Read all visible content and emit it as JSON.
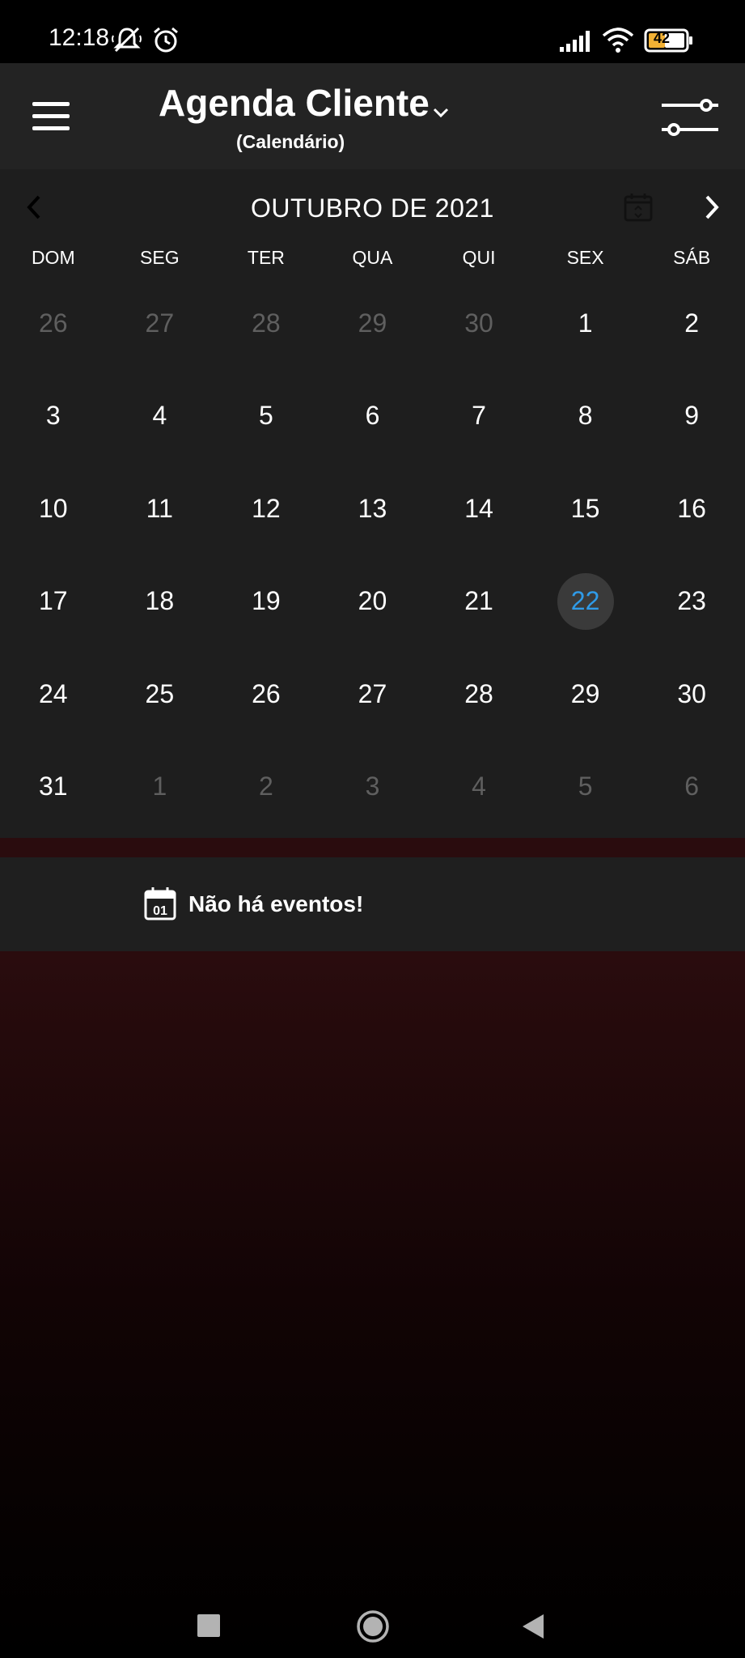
{
  "status_bar": {
    "time": "12:18",
    "battery": "42",
    "icons": [
      "muted-bell-icon",
      "alarm-icon",
      "signal-icon",
      "wifi-icon",
      "battery-icon"
    ]
  },
  "app_bar": {
    "title": "Agenda Cliente",
    "subtitle": "(Calendário)",
    "icons": [
      "menu-icon",
      "chevron-down-icon",
      "filter-sliders-icon"
    ]
  },
  "calendar": {
    "month_label": "OUTUBRO DE 2021",
    "weekdays": [
      "DOM",
      "SEG",
      "TER",
      "QUA",
      "QUI",
      "SEX",
      "SÁB"
    ],
    "weeks": [
      [
        {
          "d": "26",
          "m": true
        },
        {
          "d": "27",
          "m": true
        },
        {
          "d": "28",
          "m": true
        },
        {
          "d": "29",
          "m": true
        },
        {
          "d": "30",
          "m": true
        },
        {
          "d": "1"
        },
        {
          "d": "2"
        }
      ],
      [
        {
          "d": "3"
        },
        {
          "d": "4"
        },
        {
          "d": "5"
        },
        {
          "d": "6"
        },
        {
          "d": "7"
        },
        {
          "d": "8"
        },
        {
          "d": "9"
        }
      ],
      [
        {
          "d": "10"
        },
        {
          "d": "11"
        },
        {
          "d": "12"
        },
        {
          "d": "13"
        },
        {
          "d": "14"
        },
        {
          "d": "15"
        },
        {
          "d": "16"
        }
      ],
      [
        {
          "d": "17"
        },
        {
          "d": "18"
        },
        {
          "d": "19"
        },
        {
          "d": "20"
        },
        {
          "d": "21"
        },
        {
          "d": "22",
          "today": true
        },
        {
          "d": "23"
        }
      ],
      [
        {
          "d": "24"
        },
        {
          "d": "25"
        },
        {
          "d": "26"
        },
        {
          "d": "27"
        },
        {
          "d": "28"
        },
        {
          "d": "29"
        },
        {
          "d": "30"
        }
      ],
      [
        {
          "d": "31"
        },
        {
          "d": "1",
          "m": true
        },
        {
          "d": "2",
          "m": true
        },
        {
          "d": "3",
          "m": true
        },
        {
          "d": "4",
          "m": true
        },
        {
          "d": "5",
          "m": true
        },
        {
          "d": "6",
          "m": true
        }
      ]
    ],
    "today_color": "#2f9be8"
  },
  "events": {
    "empty_text": "Não há eventos!",
    "icon_day": "01"
  },
  "nav_bar": {
    "icons": [
      "recents-square-icon",
      "home-circle-icon",
      "back-triangle-icon"
    ]
  }
}
